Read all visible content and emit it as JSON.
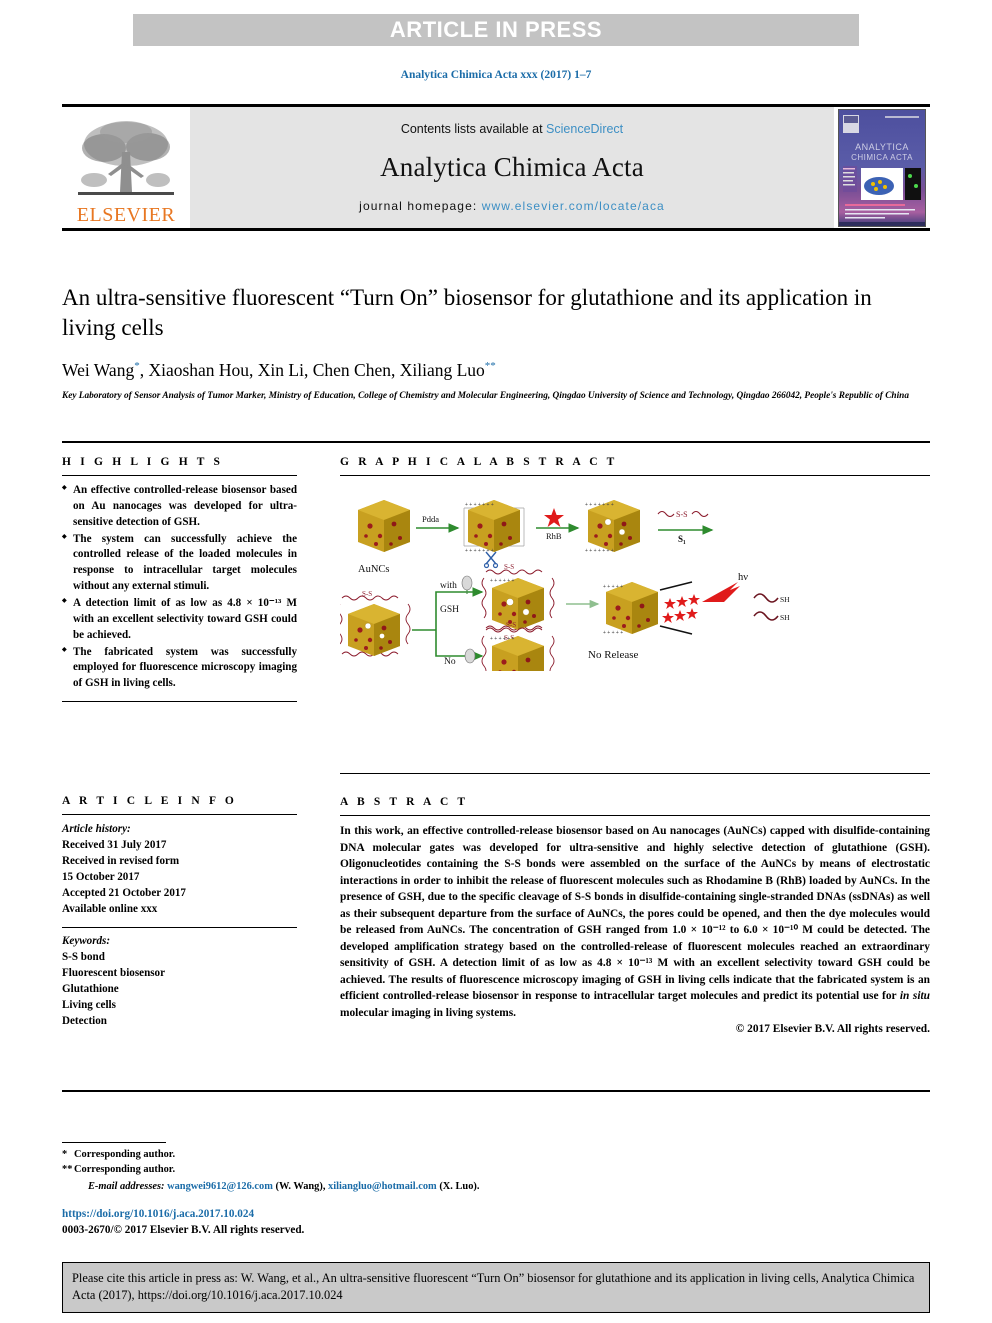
{
  "banner": {
    "label": "ARTICLE IN PRESS",
    "band_color": "#c3c3c3",
    "text_color": "#ffffff"
  },
  "journal_ref": "Analytica Chimica Acta xxx (2017) 1–7",
  "masthead": {
    "publisher_word": "ELSEVIER",
    "publisher_color": "#e87722",
    "contents_prefix": "Contents lists available at ",
    "contents_link": "ScienceDirect",
    "journal_title": "Analytica Chimica Acta",
    "homepage_prefix": "journal homepage: ",
    "homepage_link": "www.elsevier.com/locate/aca",
    "link_color": "#3d8fc4",
    "cover_title_line1": "ANALYTICA",
    "cover_title_line2": "CHIMICA ACTA"
  },
  "article": {
    "title": "An ultra-sensitive fluorescent “Turn On” biosensor for glutathione and its application in living cells",
    "authors_parts": [
      {
        "name": "Wei Wang",
        "mark": "*"
      },
      {
        "name": ", Xiaoshan Hou, Xin Li, Chen Chen, Xiliang Luo",
        "mark": "**"
      }
    ],
    "affiliation": "Key Laboratory of Sensor Analysis of Tumor Marker, Ministry of Education, College of Chemistry and Molecular Engineering, Qingdao University of Science and Technology, Qingdao 266042, People's Republic of China"
  },
  "highlights": {
    "heading": "H I G H L I G H T S",
    "items": [
      "An effective controlled-release biosensor based on Au nanocages was developed for ultra-sensitive detection of GSH.",
      "The system can successfully achieve the controlled release of the loaded molecules in response to intracellular target molecules without any external stimuli.",
      "A detection limit of as low as 4.8 × 10⁻¹³ M with an excellent selectivity toward GSH could be achieved.",
      "The fabricated system was successfully employed for fluorescence microscopy imaging of GSH in living cells."
    ]
  },
  "article_info": {
    "heading": "A R T I C L E   I N F O",
    "history_label": "Article history:",
    "history_lines": [
      "Received 31 July 2017",
      "Received in revised form",
      "15 October 2017",
      "Accepted 21 October 2017",
      "Available online xxx"
    ],
    "keywords_label": "Keywords:",
    "keywords": [
      "S-S bond",
      "Fluorescent biosensor",
      "Glutathione",
      "Living cells",
      "Detection"
    ]
  },
  "graphical_abstract": {
    "heading": "G R A P H I C A L   A B S T R A C T",
    "labels": {
      "aunc": "AuNCs",
      "pdda": "Pdda",
      "rhb": "RhB",
      "s1": "S₁",
      "ss_top": "S-S",
      "with": "with",
      "gsh": "GSH",
      "no": "No",
      "no_release": "No Release",
      "hv": "hν",
      "sh1": "SH",
      "sh2": "SH",
      "ss_cage_top": "S-S",
      "ss_cage_bottom": "S-S"
    },
    "colors": {
      "gold": "#c8a020",
      "gold_dark": "#9c7a12",
      "pore": "#a01c1c",
      "arrow_green": "#2e8b2e",
      "star_red": "#e01b1b",
      "ss_red": "#8c1d2e",
      "scissors_blue": "#2f5fa8"
    }
  },
  "abstract": {
    "heading": "A B S T R A C T",
    "paragraph_1": "In this work, an effective controlled-release biosensor based on Au nanocages (AuNCs) capped with disulfide-containing DNA molecular gates was developed for ultra-sensitive and highly selective detection of glutathione (GSH). Oligonucleotides containing the S-S bonds were assembled on the surface of the AuNCs by means of electrostatic interactions in order to inhibit the release of fluorescent molecules such as Rhodamine B (RhB) loaded by AuNCs. In the presence of GSH, due to the specific cleavage of S-S bonds in disulfide-containing single-stranded DNAs (ssDNAs) as well as their subsequent departure from the surface of AuNCs, the pores could be opened, and then the dye molecules would be released from AuNCs. The concentration of GSH ranged from 1.0 × 10⁻¹² to 6.0 × 10⁻¹⁰ M could be detected. The developed amplification strategy based on the controlled-release of fluorescent molecules reached an extraordinary sensitivity of GSH. A detection limit of as low as 4.8 × 10⁻¹³ M with an excellent selectivity toward GSH could be achieved. The results of fluorescence microscopy imaging of GSH in living cells indicate that the fabricated system is an efficient controlled-release biosensor in response to intracellular target molecules and predict its potential use for ",
    "italic_phrase": "in situ",
    "paragraph_1_tail": " molecular imaging in living systems.",
    "copyright": "© 2017 Elsevier B.V. All rights reserved."
  },
  "footnotes": {
    "corresponding_1_mark": "*",
    "corresponding_1": "Corresponding author.",
    "corresponding_2_mark": "**",
    "corresponding_2": "Corresponding author.",
    "emails_label": "E-mail addresses:",
    "email_1": "wangwei9612@126.com",
    "email_1_owner": "(W. Wang),",
    "email_2": "xiliangluo@hotmail.com",
    "email_2_owner": "(X. Luo).",
    "doi": "https://doi.org/10.1016/j.aca.2017.10.024",
    "issn_line": "0003-2670/© 2017 Elsevier B.V. All rights reserved.",
    "link_color": "#1b6ca8"
  },
  "cite_box": {
    "text": "Please cite this article in press as: W. Wang, et al., An ultra-sensitive fluorescent “Turn On” biosensor for glutathione and its application in living cells, Analytica Chimica Acta (2017), https://doi.org/10.1016/j.aca.2017.10.024",
    "background": "#c9c9c9"
  }
}
